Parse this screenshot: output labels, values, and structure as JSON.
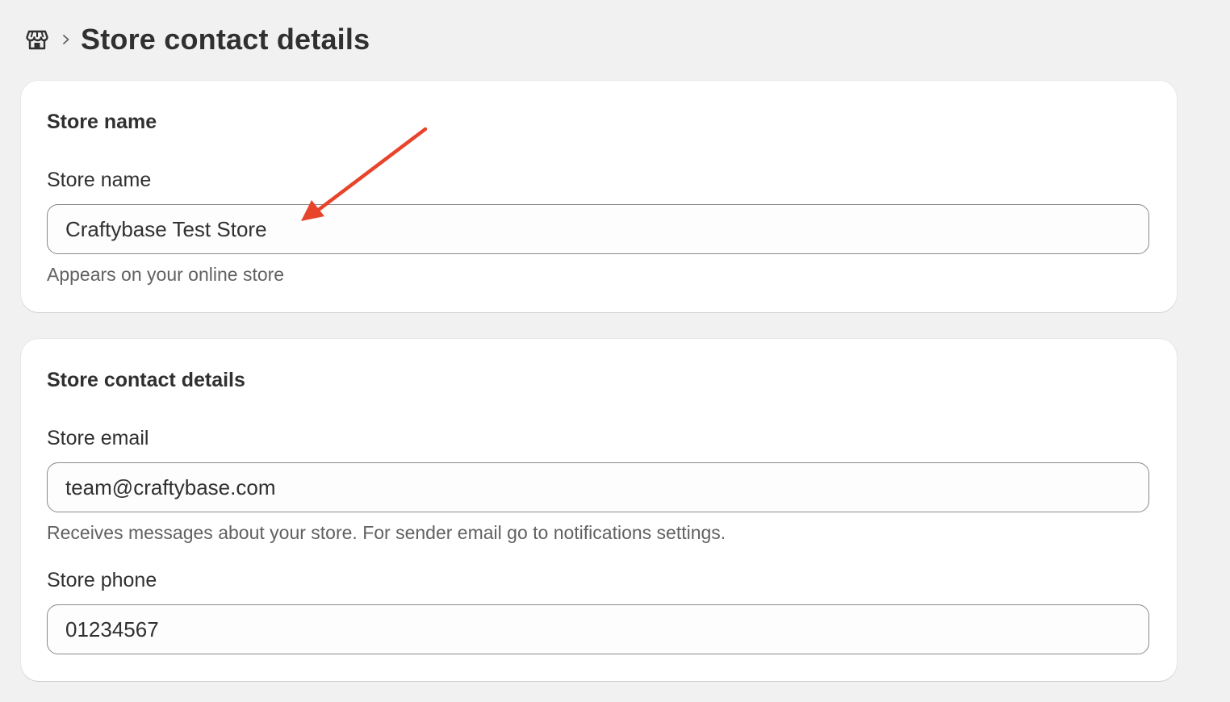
{
  "breadcrumb": {
    "home_icon": "store-icon",
    "separator_icon": "chevron-right-icon",
    "title": "Store contact details"
  },
  "store_name_card": {
    "title": "Store name",
    "field_label": "Store name",
    "field_value": "Craftybase Test Store",
    "help_text": "Appears on your online store"
  },
  "contact_card": {
    "title": "Store contact details",
    "email": {
      "label": "Store email",
      "value": "team@craftybase.com",
      "help_text": "Receives messages about your store. For sender email go to notifications settings."
    },
    "phone": {
      "label": "Store phone",
      "value": "01234567"
    }
  },
  "annotation": {
    "arrow_color": "#e8442c"
  }
}
